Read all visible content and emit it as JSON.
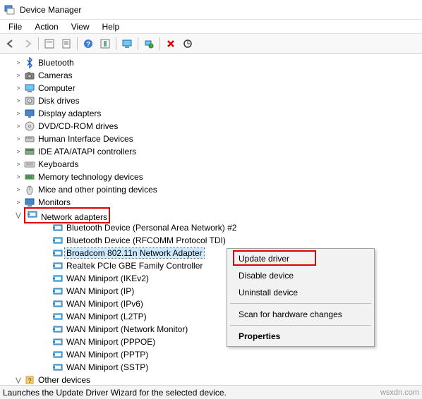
{
  "window": {
    "title": "Device Manager"
  },
  "menu": {
    "file": "File",
    "action": "Action",
    "view": "View",
    "help": "Help"
  },
  "toolbar_icons": {
    "back": "back-icon",
    "forward": "forward-icon",
    "show_hidden": "show-hidden-icon",
    "properties": "properties-icon",
    "help": "help-icon",
    "console": "console-icon",
    "monitors": "monitors-icon",
    "scan": "scan-hardware-icon",
    "uninstall": "uninstall-icon",
    "update": "update-driver-icon"
  },
  "tree": {
    "categories": [
      {
        "key": "bluetooth",
        "label": "Bluetooth",
        "icon": "bluetooth"
      },
      {
        "key": "cameras",
        "label": "Cameras",
        "icon": "camera"
      },
      {
        "key": "computer",
        "label": "Computer",
        "icon": "computer"
      },
      {
        "key": "disk_drives",
        "label": "Disk drives",
        "icon": "disk"
      },
      {
        "key": "display_adapters",
        "label": "Display adapters",
        "icon": "display"
      },
      {
        "key": "dvd",
        "label": "DVD/CD-ROM drives",
        "icon": "dvd"
      },
      {
        "key": "hid",
        "label": "Human Interface Devices",
        "icon": "hid"
      },
      {
        "key": "ide",
        "label": "IDE ATA/ATAPI controllers",
        "icon": "ide"
      },
      {
        "key": "keyboards",
        "label": "Keyboards",
        "icon": "keyboard"
      },
      {
        "key": "memory",
        "label": "Memory technology devices",
        "icon": "memory"
      },
      {
        "key": "mice",
        "label": "Mice and other pointing devices",
        "icon": "mouse"
      },
      {
        "key": "monitors",
        "label": "Monitors",
        "icon": "monitor"
      },
      {
        "key": "network",
        "label": "Network adapters",
        "icon": "network",
        "expanded": true,
        "highlighted": true,
        "children": [
          {
            "label": "Bluetooth Device (Personal Area Network) #2"
          },
          {
            "label": "Bluetooth Device (RFCOMM Protocol TDI)"
          },
          {
            "label": "Broadcom 802.11n Network Adapter",
            "selected": true
          },
          {
            "label": "Realtek PCIe GBE Family Controller"
          },
          {
            "label": "WAN Miniport (IKEv2)"
          },
          {
            "label": "WAN Miniport (IP)"
          },
          {
            "label": "WAN Miniport (IPv6)"
          },
          {
            "label": "WAN Miniport (L2TP)"
          },
          {
            "label": "WAN Miniport (Network Monitor)"
          },
          {
            "label": "WAN Miniport (PPPOE)"
          },
          {
            "label": "WAN Miniport (PPTP)"
          },
          {
            "label": "WAN Miniport (SSTP)"
          }
        ]
      },
      {
        "key": "other",
        "label": "Other devices",
        "icon": "other",
        "expanded": true
      }
    ]
  },
  "context_menu": {
    "update": "Update driver",
    "disable": "Disable device",
    "uninstall": "Uninstall device",
    "scan": "Scan for hardware changes",
    "properties": "Properties",
    "highlighted": "update"
  },
  "status": {
    "text": "Launches the Update Driver Wizard for the selected device."
  },
  "watermark": "wsxdn.com"
}
